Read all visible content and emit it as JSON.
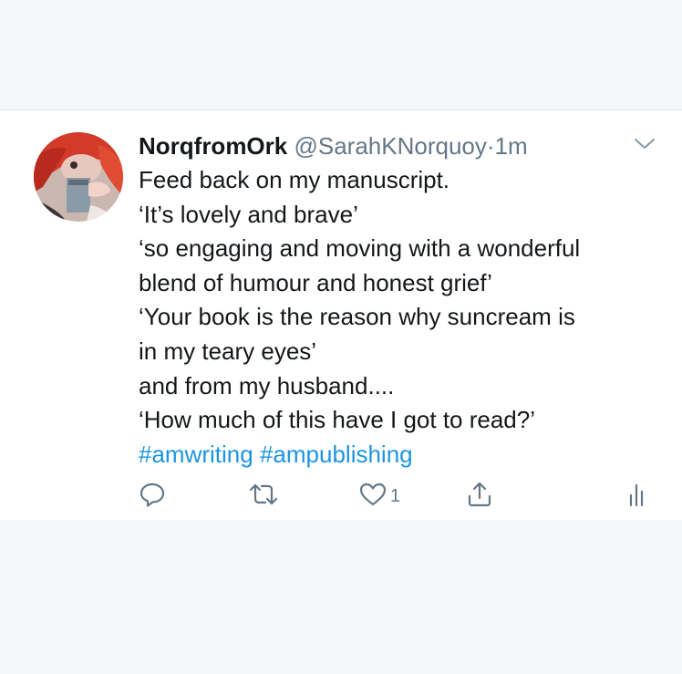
{
  "tweet": {
    "display_name": "NorqfromOrk",
    "handle": "@SarahKNorquoy",
    "separator": "·",
    "time": "1m",
    "lines": [
      "Feed back on my manuscript.",
      "‘It’s lovely and brave’",
      "‘so engaging and moving with a wonderful",
      "blend of humour and honest grief’",
      "‘Your book is the reason why suncream is",
      "in my teary eyes’",
      "and from my husband....",
      "‘How much of this have I got to read?’"
    ],
    "hashtags": [
      "#amwriting",
      "#ampublishing"
    ],
    "actions": {
      "reply_icon": "reply-icon",
      "retweet_icon": "retweet-icon",
      "like_icon": "heart-icon",
      "like_count": "1",
      "share_icon": "share-icon",
      "analytics_icon": "analytics-icon"
    },
    "colors": {
      "link": "#1b95e0",
      "secondary_text": "#657786",
      "primary_text": "#14171a",
      "background": "#f5f8fa"
    }
  }
}
